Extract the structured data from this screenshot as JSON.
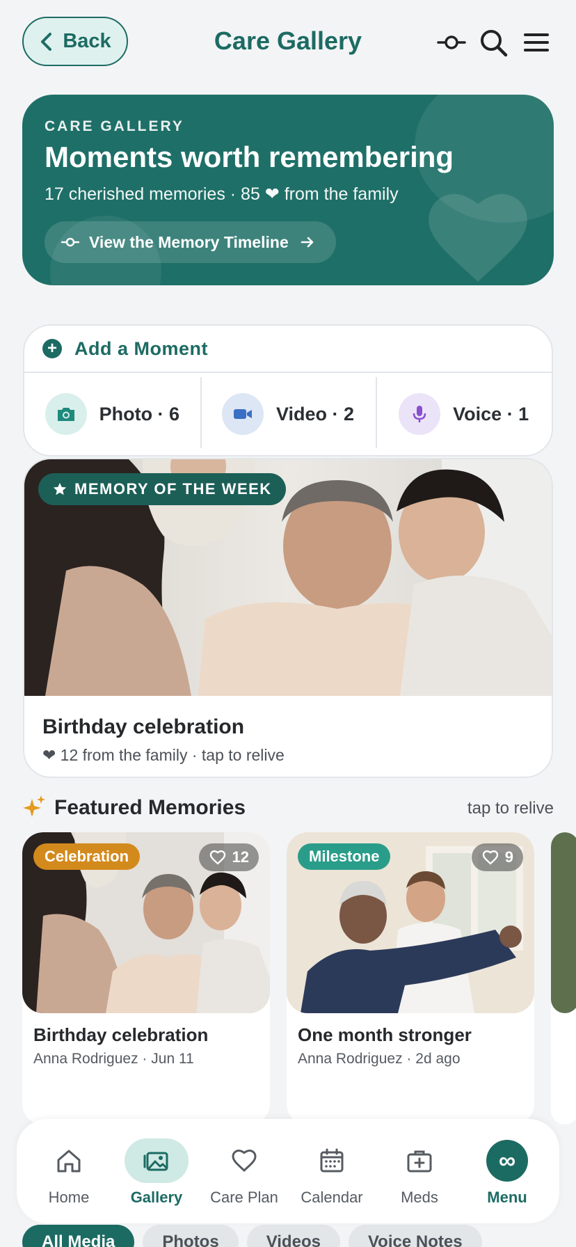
{
  "header": {
    "back_label": "Back",
    "title": "Care Gallery"
  },
  "hero": {
    "kicker": "CARE GALLERY",
    "headline": "Moments worth remembering",
    "summary": "17 cherished memories  ·  85 ❤ from the family",
    "timeline_button": "View the Memory Timeline"
  },
  "add_moment": {
    "label": "Add a Moment",
    "media": [
      {
        "label": "Photo · 6",
        "icon": "camera-icon",
        "bg": "#d8efec",
        "color": "#1e8a7c"
      },
      {
        "label": "Video · 2",
        "icon": "video-icon",
        "bg": "#dde6f4",
        "color": "#3b6fc4"
      },
      {
        "label": "Voice · 1",
        "icon": "microphone-icon",
        "bg": "#ebe3f7",
        "color": "#8a4fd0"
      }
    ]
  },
  "memory_of_week": {
    "badge": "MEMORY OF THE WEEK",
    "title": "Birthday celebration",
    "meta": "❤ 12 from the family · tap to relive"
  },
  "featured": {
    "title": "Featured Memories",
    "hint": "tap to relive",
    "cards": [
      {
        "tag": "Celebration",
        "tag_color": "#d38a1c",
        "likes": "12",
        "title": "Birthday celebration",
        "meta": "Anna Rodriguez · Jun 11"
      },
      {
        "tag": "Milestone",
        "tag_color": "#2a9d8a",
        "likes": "9",
        "title": "One month stronger",
        "meta": "Anna Rodriguez · 2d ago"
      }
    ]
  },
  "bottom_nav": [
    {
      "label": "Home",
      "icon": "home-icon"
    },
    {
      "label": "Gallery",
      "icon": "gallery-icon",
      "active": true
    },
    {
      "label": "Care Plan",
      "icon": "heart-icon"
    },
    {
      "label": "Calendar",
      "icon": "calendar-icon"
    },
    {
      "label": "Meds",
      "icon": "medkit-icon"
    },
    {
      "label": "Menu",
      "icon": "infinity-icon"
    }
  ],
  "filters": [
    "All Media",
    "Photos",
    "Videos",
    "Voice Notes"
  ],
  "colors": {
    "brand": "#1c6b63",
    "background": "#f3f4f6"
  }
}
